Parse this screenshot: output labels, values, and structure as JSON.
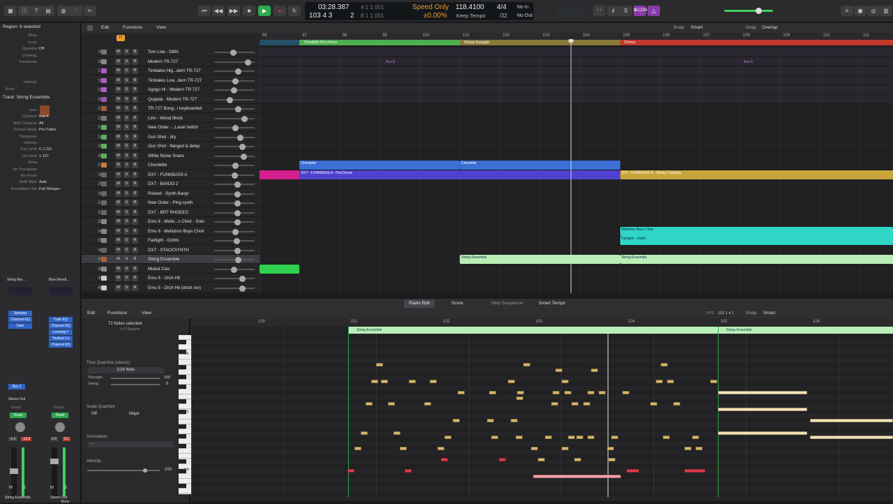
{
  "transport": {
    "position": "03:28.387",
    "bars": "103  4  3",
    "subtick": "2",
    "beatrow1": "4  1  1  001",
    "beatrow2": "8  1  1  001",
    "speed_mode": "Speed Only",
    "speed_pct": "±0.00%",
    "tempo": "118.4100",
    "tempo_mode": "Keep Tempo",
    "signature": "4/4",
    "division": "/32",
    "in": "No In",
    "out": "No Out",
    "badge": "⌘1234"
  },
  "toolbar": {
    "edit": "Edit",
    "functions": "Functions",
    "view": "View",
    "snap_label": "Snap:",
    "snap": "Smart",
    "drag_label": "Drag:",
    "drag": "Overlap"
  },
  "inspector": {
    "region_header": "Region: 6 selected",
    "region_rows": [
      {
        "k": "Mute:",
        "v": ""
      },
      {
        "k": "Loop:",
        "v": ""
      },
      {
        "k": "Quantize",
        "v": "Off"
      },
      {
        "k": "Q-Swing:",
        "v": ""
      },
      {
        "k": "Transpose:",
        "v": ""
      },
      {
        "k": "",
        "v": ""
      },
      {
        "k": "",
        "v": ""
      },
      {
        "k": "Velocity:",
        "v": ""
      }
    ],
    "more": "More",
    "track_header": "Track:  String Ensemble",
    "track_rows": [
      {
        "k": "Icon:",
        "v": ""
      },
      {
        "k": "Channel:",
        "v": "Inst 4"
      },
      {
        "k": "MIDI Channel:",
        "v": "All"
      },
      {
        "k": "Freeze Mode:",
        "v": "Pre Fader"
      },
      {
        "k": "Transpose:",
        "v": ""
      },
      {
        "k": "Velocity:",
        "v": ""
      },
      {
        "k": "Key Limit:",
        "v": "C-1  G9"
      },
      {
        "k": "Vel Limit:",
        "v": "1  127"
      },
      {
        "k": "Delay",
        "v": ""
      },
      {
        "k": "No Transpose:",
        "v": ""
      },
      {
        "k": "No Reset:",
        "v": ""
      },
      {
        "k": "Staff Style:",
        "v": "Auto"
      },
      {
        "k": "Articulation Set:",
        "v": "Full Strings+"
      }
    ],
    "strip_left": {
      "name": "String Bre...",
      "plugin1": "Sampler",
      "plugin2": "Channel EQ",
      "plugin3": "Gain",
      "bus": "Bus 1",
      "out": "Stereo Out",
      "group": "Group",
      "read": "Read",
      "vol": "-6.6",
      "peak": "-16.8",
      "bottom": "String Ensemble",
      "m": "M",
      "s": "S"
    },
    "strip_right": {
      "name": "Blue Mondl...",
      "plugin1": "Tube EQ",
      "plugin2": "Channel EQ",
      "plugin3": "Leveling T",
      "plugin4": "Youlean Lo",
      "plugin5": "Channel EQ",
      "group": "Group",
      "read": "Read",
      "vol": "0.0",
      "peak": "0.1",
      "bnce": "Bnce",
      "bottom": "Stereo Out",
      "m": "M",
      "s": "S"
    }
  },
  "ruler": [
    "96",
    "97",
    "98",
    "99",
    "100",
    "101",
    "102",
    "103",
    "104",
    "105",
    "106",
    "107",
    "108",
    "109",
    "110",
    "111"
  ],
  "markers": [
    {
      "label": "Chordette Pre-chorus",
      "color": "#4caf50"
    },
    {
      "label": "Strings Arpeggio",
      "color": "#8a7a3a"
    },
    {
      "label": "Chorus",
      "color": "#c0392b"
    }
  ],
  "aux_labels": [
    "Aux 8",
    "Aux 8"
  ],
  "tracks": [
    {
      "num": "15",
      "name": "Tom Low - DMX",
      "icon": "#777",
      "vol": 0.45
    },
    {
      "num": "16",
      "name": "Modern TR-727",
      "icon": "#888",
      "vol": 0.88
    },
    {
      "num": "17",
      "name": "Timbales Hig...dern TR-727",
      "icon": "#b05ac8",
      "vol": 0.6
    },
    {
      "num": "18",
      "name": "Timbales Low...dern TR-727",
      "icon": "#b05ac8",
      "vol": 0.52
    },
    {
      "num": "19",
      "name": "Agogo Hi - Modern TR-727",
      "icon": "#b05ac8",
      "vol": 0.48
    },
    {
      "num": "20",
      "name": "Quijada - Modern TR-727",
      "icon": "#9a5ab0",
      "vol": 0.35
    },
    {
      "num": "21",
      "name": "TR-727 Bong...i keyboarded",
      "icon": "#a0603a",
      "vol": 0.6
    },
    {
      "num": "22",
      "name": "Linn - Wood Block",
      "icon": "#777",
      "vol": 0.78
    },
    {
      "num": "23",
      "name": "New Order -...Laser twitch",
      "icon": "#5ab05a",
      "vol": 0.52
    },
    {
      "num": "24",
      "name": "Gun Shot - dry",
      "icon": "#5ab05a",
      "vol": 0.65
    },
    {
      "num": "25",
      "name": "Gun Shot - flanged & delay",
      "icon": "#5ab05a",
      "vol": 0.72
    },
    {
      "num": "26",
      "name": "White Noise Snare",
      "icon": "#5ab05a",
      "vol": 0.75
    },
    {
      "num": "27",
      "name": "Chordette",
      "icon": "#c87a3a",
      "vol": 0.52
    },
    {
      "num": "28",
      "name": "DX7 - FUNKBASS A",
      "icon": "#666",
      "vol": 0.5
    },
    {
      "num": "29",
      "name": "DX7 - BANJO 2",
      "icon": "#666",
      "vol": 0.58
    },
    {
      "num": "30",
      "name": "Roland - Synth Banjo",
      "icon": "#666",
      "vol": 0.58
    },
    {
      "num": "31",
      "name": "New Order - Ping synth",
      "icon": "#666",
      "vol": 0.58
    },
    {
      "num": "32",
      "name": "DX7 - BRT RHODES",
      "icon": "#666",
      "vol": 0.58
    },
    {
      "num": "33",
      "name": "Emu II - Mello...s Choir - Solo",
      "icon": "#888",
      "vol": 0.58
    },
    {
      "num": "34",
      "name": "Emu II - Mellotron Boys Choir",
      "icon": "#888",
      "vol": 0.52
    },
    {
      "num": "35",
      "name": "Fairlight - Oohhi",
      "icon": "#888",
      "vol": 0.55
    },
    {
      "num": "36",
      "name": "DX7 - STACKSYNTH",
      "icon": "#666",
      "vol": 0.58
    },
    {
      "num": "37",
      "name": "String Ensemble",
      "icon": "#b0603a",
      "vol": 0.6
    },
    {
      "num": "38",
      "name": "Muted Clav",
      "icon": "#888",
      "vol": 0.48
    },
    {
      "num": "39",
      "name": "Emu II - Orch Hit",
      "icon": "#ccc",
      "vol": 0.72
    },
    {
      "num": "40",
      "name": "Emu II - Orch Hit (short rev)",
      "icon": "#ccc",
      "vol": 0.72
    }
  ],
  "regions": [
    {
      "label": "Chordette",
      "color": "#3b6fd6"
    },
    {
      "label": "Chordette",
      "color": "#3b6fd6"
    },
    {
      "label": "DX7 - FUNKBASS A - PreChorus",
      "color": "#5040cf"
    },
    {
      "label": "DX7 - FUNKBASS A - Stroby Comping",
      "color": "#c9a43a"
    },
    {
      "label": "",
      "color": "#d4218f"
    },
    {
      "label": "Mellotron Boys Choir",
      "color": "#2fd6c6"
    },
    {
      "label": "Fairlight - Oohhi",
      "color": "#2fd6c6"
    },
    {
      "label": "String Ensemble",
      "color": "#b9efb6"
    },
    {
      "label": "String Ensemble",
      "color": "#b9efb6"
    },
    {
      "label": "",
      "color": "#2fcf4f"
    }
  ],
  "editor_tabs": [
    "Piano Roll",
    "Score",
    "Step Sequencer",
    "Smart Tempo"
  ],
  "pianoroll": {
    "edit": "Edit",
    "functions": "Functions",
    "view": "View",
    "selected": "72 Notes selected",
    "in_regions": "in 6 Regions",
    "pos_label": "DPS",
    "pos": "102 1 4 1",
    "snap_label": "Snap:",
    "snap": "Smart",
    "tq_label": "Time Quantize (classic)",
    "tq": "1/16 Note",
    "strength_label": "Strength",
    "strength": "100",
    "swing_label": "Swing",
    "swing": "0",
    "sq_label": "Scale Quantize",
    "sq": "Off",
    "scale": "Major",
    "artic_label": "Articulation",
    "artic": "--",
    "velocity_label": "Velocity",
    "velocity": "100",
    "ruler": [
      "100",
      "101",
      "102",
      "103",
      "104",
      "105",
      "106"
    ],
    "region_labels": [
      "String Ensemble",
      "String Ensemble"
    ],
    "octaves": [
      "C6",
      "C5",
      "C4"
    ]
  },
  "colors": {
    "note": "#d9b56a",
    "note_red": "#e03a4a",
    "note_long": "#f3e3b5",
    "selected_long": "#f5a0a8",
    "playhead": "#e0e0e0"
  }
}
